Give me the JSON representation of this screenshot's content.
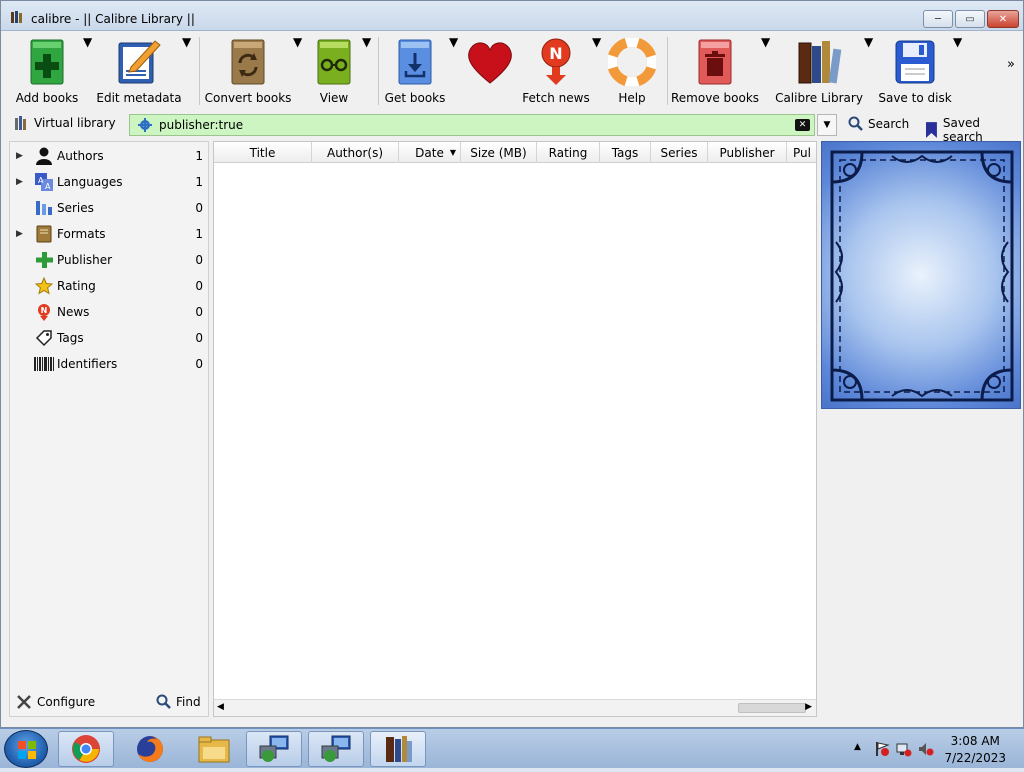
{
  "window": {
    "title": "calibre - || Calibre Library ||",
    "minimize_glyph": "─",
    "maximize_glyph": "▭",
    "close_glyph": "✕"
  },
  "toolbar": {
    "items": [
      {
        "label": "Add books",
        "icon": "add-books-icon",
        "has_menu": true
      },
      {
        "label": "Edit metadata",
        "icon": "edit-metadata-icon",
        "has_menu": true
      },
      {
        "label": "Convert books",
        "icon": "convert-books-icon",
        "has_menu": true
      },
      {
        "label": "View",
        "icon": "view-icon",
        "has_menu": true
      },
      {
        "label": "Get books",
        "icon": "get-books-icon",
        "has_menu": true
      },
      {
        "label": "",
        "icon": "donate-heart-icon",
        "has_menu": false
      },
      {
        "label": "Fetch news",
        "icon": "fetch-news-icon",
        "has_menu": true
      },
      {
        "label": "Help",
        "icon": "help-lifebuoy-icon",
        "has_menu": false
      },
      {
        "label": "Remove books",
        "icon": "remove-books-icon",
        "has_menu": true
      },
      {
        "label": "Calibre Library",
        "icon": "calibre-library-icon",
        "has_menu": true
      },
      {
        "label": "Save to disk",
        "icon": "save-to-disk-icon",
        "has_menu": true
      }
    ],
    "overflow_glyph": "»"
  },
  "search": {
    "virtual_library_label": "Virtual library",
    "query": "publisher:true",
    "search_label": "Search",
    "saved_search_label": "Saved search",
    "highlight_color": "#cdf5c2"
  },
  "tag_browser": {
    "items": [
      {
        "label": "Authors",
        "count": "1",
        "expandable": true,
        "icon": "person-icon"
      },
      {
        "label": "Languages",
        "count": "1",
        "expandable": true,
        "icon": "languages-icon"
      },
      {
        "label": "Series",
        "count": "0",
        "expandable": false,
        "icon": "series-icon"
      },
      {
        "label": "Formats",
        "count": "1",
        "expandable": true,
        "icon": "formats-book-icon"
      },
      {
        "label": "Publisher",
        "count": "0",
        "expandable": false,
        "icon": "publisher-plus-icon"
      },
      {
        "label": "Rating",
        "count": "0",
        "expandable": false,
        "icon": "star-icon"
      },
      {
        "label": "News",
        "count": "0",
        "expandable": false,
        "icon": "news-icon"
      },
      {
        "label": "Tags",
        "count": "0",
        "expandable": false,
        "icon": "tag-icon"
      },
      {
        "label": "Identifiers",
        "count": "0",
        "expandable": false,
        "icon": "barcode-icon"
      }
    ],
    "configure_label": "Configure",
    "find_label": "Find"
  },
  "book_list": {
    "columns": [
      {
        "label": "Title",
        "sorted": false
      },
      {
        "label": "Author(s)",
        "sorted": false
      },
      {
        "label": "Date",
        "sorted": true
      },
      {
        "label": "Size (MB)",
        "sorted": false
      },
      {
        "label": "Rating",
        "sorted": false
      },
      {
        "label": "Tags",
        "sorted": false
      },
      {
        "label": "Series",
        "sorted": false
      },
      {
        "label": "Publisher",
        "sorted": false
      },
      {
        "label": "Pul",
        "sorted": false
      }
    ],
    "rows": []
  },
  "taskbar": {
    "apps": [
      "chrome-icon",
      "firefox-icon",
      "file-explorer-icon",
      "network-app-icon",
      "network-app-icon",
      "calibre-icon"
    ],
    "clock_time": "3:08 AM",
    "clock_date": "7/22/2023",
    "tray_arrow": "▲"
  }
}
